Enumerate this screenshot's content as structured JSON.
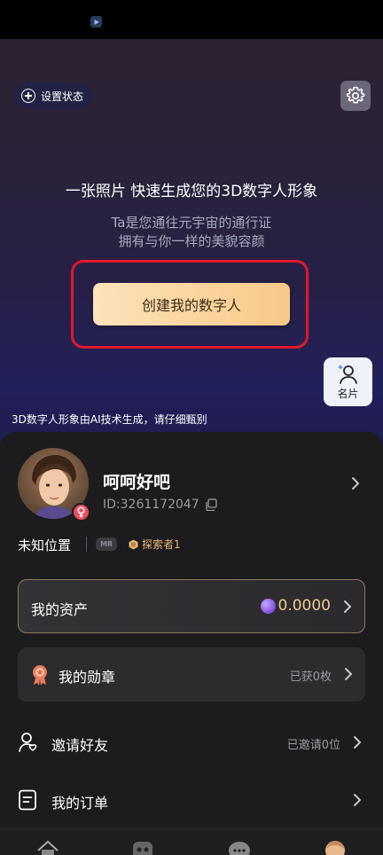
{
  "hero": {
    "status_chip_label": "设置状态",
    "title": "一张照片 快速生成您的3D数字人形象",
    "subtitle_line1": "Ta是您通往元宇宙的通行证",
    "subtitle_line2": "拥有与你一样的美貌容颜",
    "create_button_label": "创建我的数字人",
    "card_button_label": "名片",
    "ai_notice": "3D数字人形象由AI技术生成，请仔细甄别"
  },
  "profile": {
    "nickname": "呵呵好吧",
    "user_id": "ID:3261172047",
    "location": "未知位置",
    "mr_badge": "MR",
    "level_badge": "探索者1"
  },
  "assets": {
    "label": "我的资产",
    "value": "0.0000"
  },
  "menu": {
    "medals": {
      "label": "我的勋章",
      "meta": "已获0枚"
    },
    "invite": {
      "label": "邀请好友",
      "meta": "已邀请0位"
    },
    "orders": {
      "label": "我的订单"
    }
  },
  "colors": {
    "accent_gold": "#f8c987",
    "highlight_red": "#e0182a",
    "gender_badge": "#e8505b"
  },
  "icons": [
    "play-icon",
    "plus-circle-icon",
    "gear-icon",
    "business-card-icon",
    "female-icon",
    "copy-icon",
    "chevron-right-icon",
    "vr-headset-icon",
    "explorer-badge-icon",
    "coin-icon",
    "medal-icon",
    "user-plus-icon",
    "order-list-icon",
    "home-icon",
    "robot-icon",
    "chat-icon",
    "profile-icon"
  ]
}
